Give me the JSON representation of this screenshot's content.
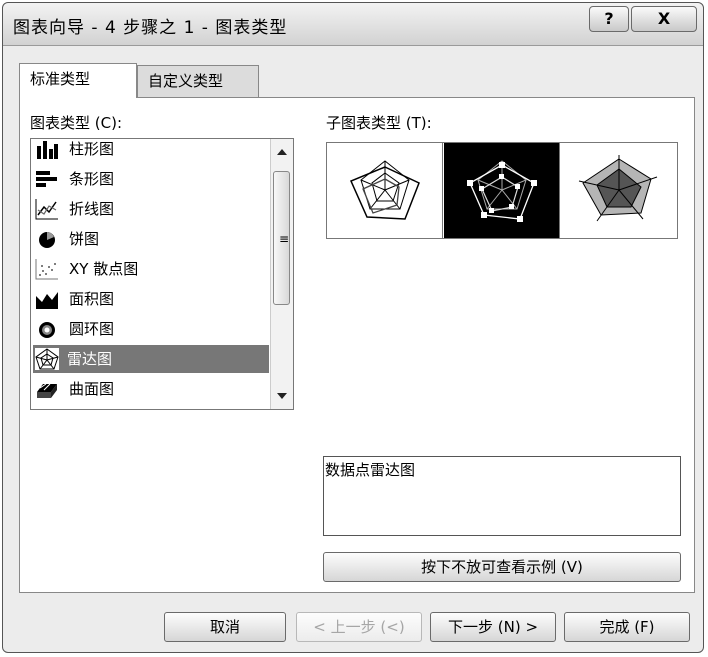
{
  "window": {
    "title": "图表向导 - 4 步骤之 1 - 图表类型",
    "help_label": "?",
    "close_label": "X"
  },
  "tabs": [
    {
      "label": "标准类型",
      "active": true
    },
    {
      "label": "自定义类型",
      "active": false
    }
  ],
  "chart_types": {
    "label": "图表类型 (C):",
    "items": [
      {
        "label": "柱形图",
        "icon": "column-chart-icon"
      },
      {
        "label": "条形图",
        "icon": "bar-chart-icon"
      },
      {
        "label": "折线图",
        "icon": "line-chart-icon"
      },
      {
        "label": "饼图",
        "icon": "pie-chart-icon"
      },
      {
        "label": "XY 散点图",
        "icon": "scatter-chart-icon"
      },
      {
        "label": "面积图",
        "icon": "area-chart-icon"
      },
      {
        "label": "圆环图",
        "icon": "doughnut-chart-icon"
      },
      {
        "label": "雷达图",
        "icon": "radar-chart-icon",
        "selected": true
      },
      {
        "label": "曲面图",
        "icon": "surface-chart-icon"
      }
    ]
  },
  "sub_types": {
    "label": "子图表类型 (T):",
    "items": [
      {
        "icon": "radar-icon",
        "selected": false
      },
      {
        "icon": "radar-with-markers-icon",
        "selected": true
      },
      {
        "icon": "filled-radar-icon",
        "selected": false
      }
    ],
    "description": "数据点雷达图"
  },
  "preview_button": "按下不放可查看示例 (V)",
  "buttons": {
    "cancel": "取消",
    "back": "< 上一步 (<)",
    "next": "下一步 (N) >",
    "finish": "完成 (F)"
  },
  "colors": {
    "selection": "#777777",
    "window_bg": "#ececec"
  }
}
